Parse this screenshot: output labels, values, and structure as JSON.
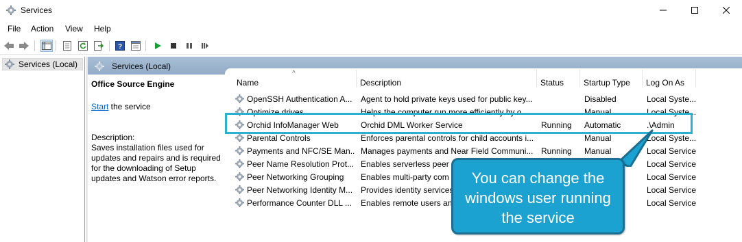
{
  "window": {
    "title": "Services"
  },
  "menu": {
    "file": "File",
    "action": "Action",
    "view": "View",
    "help": "Help"
  },
  "tree": {
    "root": "Services (Local)"
  },
  "panel": {
    "header": "Services (Local)",
    "selected_service": "Office  Source Engine",
    "start_link": "Start",
    "start_suffix": " the service",
    "description_label": "Description:",
    "description_text": "Saves installation files used for updates and repairs and is required for the downloading of Setup updates and Watson error reports."
  },
  "columns": {
    "name": "Name",
    "description": "Description",
    "status": "Status",
    "startup": "Startup Type",
    "logon": "Log On As"
  },
  "rows": [
    {
      "name": "OpenSSH Authentication A...",
      "description": "Agent to hold private keys used for public key...",
      "status": "",
      "startup": "Disabled",
      "logon": "Local Syste..."
    },
    {
      "name": "Optimize drives",
      "description": "Helps the computer run more efficiently by o...",
      "status": "",
      "startup": "Manual",
      "logon": "Local Syste..."
    },
    {
      "name": "Orchid InfoManager Web",
      "description": "Orchid DML Worker Service",
      "status": "Running",
      "startup": "Automatic",
      "logon": ".\\Admin"
    },
    {
      "name": "Parental Controls",
      "description": "Enforces parental controls for child accounts i...",
      "status": "",
      "startup": "Manual",
      "logon": "Local Syste..."
    },
    {
      "name": "Payments and NFC/SE Man...",
      "description": "Manages payments and Near Field Communi...",
      "status": "Running",
      "startup": "Manual",
      "logon": "Local Service"
    },
    {
      "name": "Peer Name Resolution Prot...",
      "description": "Enables serverless peer n",
      "status": "",
      "startup": "",
      "logon": "Local Service"
    },
    {
      "name": "Peer Networking Grouping",
      "description": "Enables multi-party com",
      "status": "",
      "startup": "",
      "logon": "Local Service"
    },
    {
      "name": "Peer Networking Identity M...",
      "description": "Provides identity services",
      "status": "",
      "startup": "",
      "logon": "Local Service"
    },
    {
      "name": "Performance Counter DLL ...",
      "description": "Enables remote users and",
      "status": "",
      "startup": "",
      "logon": "Local Service"
    }
  ],
  "callout": {
    "text": "You can change the windows user running the service"
  },
  "colors": {
    "accent": "#2bb1cf",
    "callout_bg": "#1ba2d0",
    "callout_border": "#1a6f92",
    "header_bg": "#a8bed6"
  }
}
